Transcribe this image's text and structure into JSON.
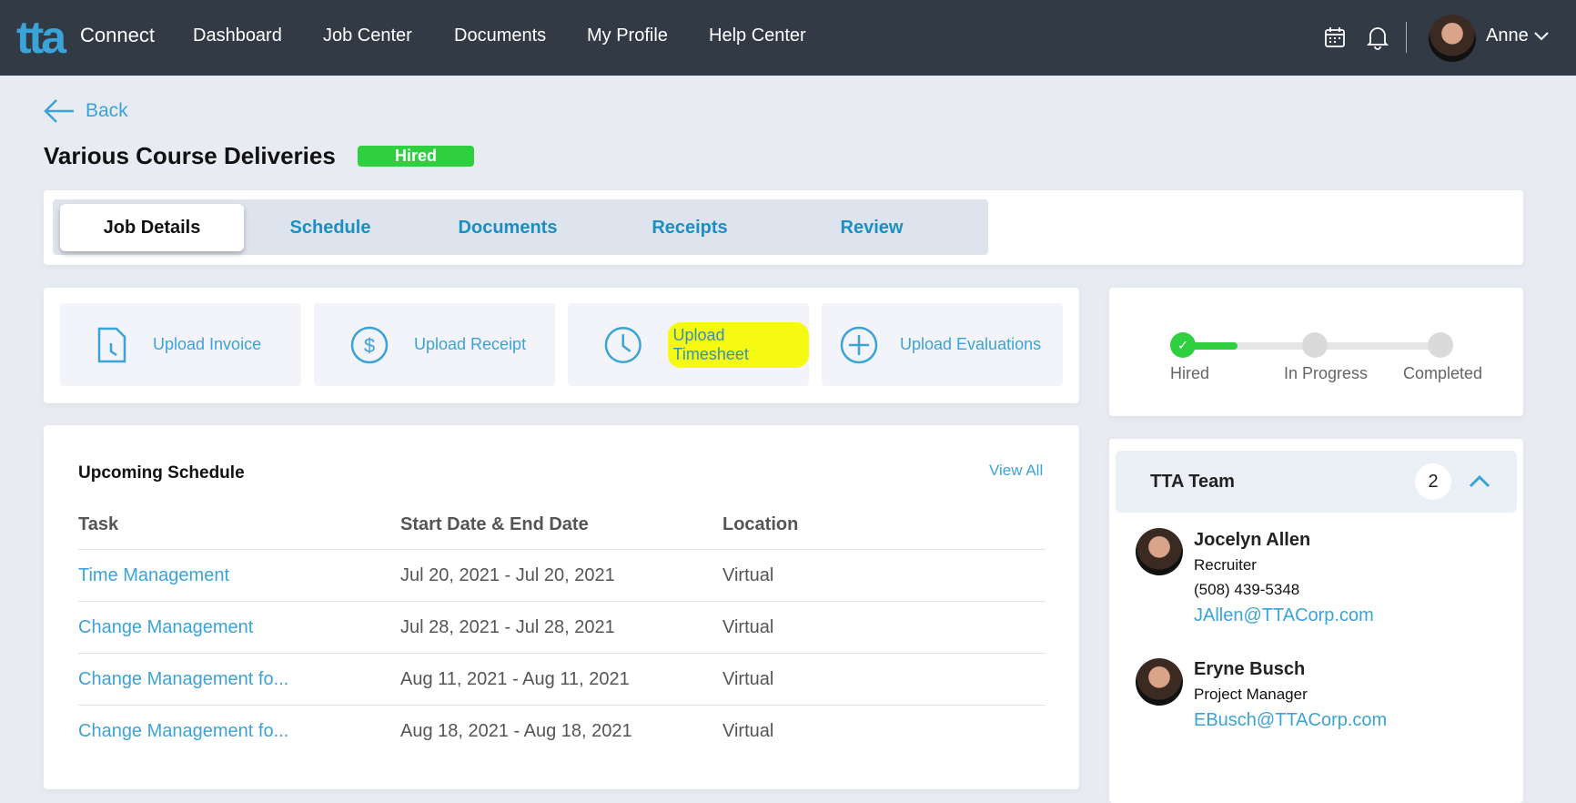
{
  "nav": {
    "logo": "tta",
    "logo_suffix": "Connect",
    "items": [
      "Dashboard",
      "Job Center",
      "Documents",
      "My Profile",
      "Help Center"
    ],
    "user": "Anne"
  },
  "back": "Back",
  "title": "Various Course Deliveries",
  "status_badge": "Hired",
  "tabs": [
    "Job Details",
    "Schedule",
    "Documents",
    "Receipts",
    "Review"
  ],
  "uploads": [
    "Upload Invoice",
    "Upload Receipt",
    "Upload Timesheet",
    "Upload Evaluations"
  ],
  "schedule": {
    "title": "Upcoming Schedule",
    "view_all": "View All",
    "columns": [
      "Task",
      "Start Date & End Date",
      "Location"
    ],
    "rows": [
      [
        "Time Management",
        "Jul 20, 2021 - Jul 20, 2021",
        "Virtual"
      ],
      [
        "Change Management",
        "Jul 28, 2021 - Jul 28, 2021",
        "Virtual"
      ],
      [
        "Change Management fo...",
        "Aug 11, 2021 - Aug 11, 2021",
        "Virtual"
      ],
      [
        "Change Management fo...",
        "Aug 18, 2021 - Aug 18, 2021",
        "Virtual"
      ]
    ]
  },
  "progress": {
    "steps": [
      "Hired",
      "In Progress",
      "Completed"
    ],
    "current_step": 1
  },
  "team": {
    "title": "TTA Team",
    "count": "2",
    "members": [
      {
        "name": "Jocelyn Allen",
        "role": "Recruiter",
        "phone": "(508) 439-5348",
        "email": "JAllen@TTACorp.com"
      },
      {
        "name": "Eryne Busch",
        "role": "Project Manager",
        "email": "EBusch@TTACorp.com"
      }
    ]
  },
  "colors": {
    "accent": "#3aa3d8",
    "success": "#2ed03f",
    "nav": "#323a46"
  }
}
